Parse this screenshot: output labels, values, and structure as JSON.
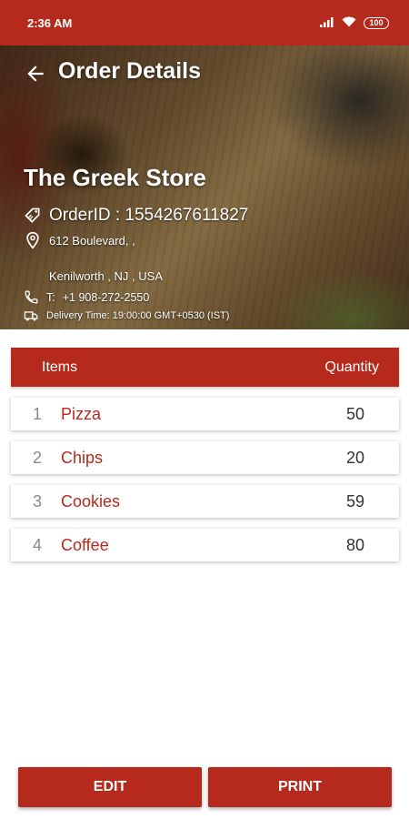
{
  "status_bar": {
    "time": "2:36 AM",
    "battery": "100"
  },
  "header": {
    "title": "Order Details",
    "store_name": "The Greek Store",
    "order_id": "OrderID : 1554267611827",
    "address_line1": "612 Boulevard, ,",
    "address_line2": "Kenilworth , NJ , USA",
    "phone_prefix": "T:",
    "phone": "+1 908-272-2550",
    "delivery_time": "Delivery Time: 19:00:00 GMT+0530 (IST)"
  },
  "table": {
    "headers": {
      "items": "Items",
      "quantity": "Quantity"
    },
    "rows": [
      {
        "num": "1",
        "name": "Pizza",
        "qty": "50"
      },
      {
        "num": "2",
        "name": "Chips",
        "qty": "20"
      },
      {
        "num": "3",
        "name": "Cookies",
        "qty": "59"
      },
      {
        "num": "4",
        "name": "Coffee",
        "qty": "80"
      }
    ]
  },
  "buttons": {
    "edit": "EDIT",
    "print": "PRINT"
  },
  "colors": {
    "accent": "#b52a1c",
    "text_item": "#b52a1c",
    "text_qty": "#333333"
  },
  "icons": [
    "back-arrow-icon",
    "tag-icon",
    "location-icon",
    "phone-icon",
    "delivery-icon",
    "signal-icon",
    "wifi-icon",
    "battery-icon"
  ]
}
